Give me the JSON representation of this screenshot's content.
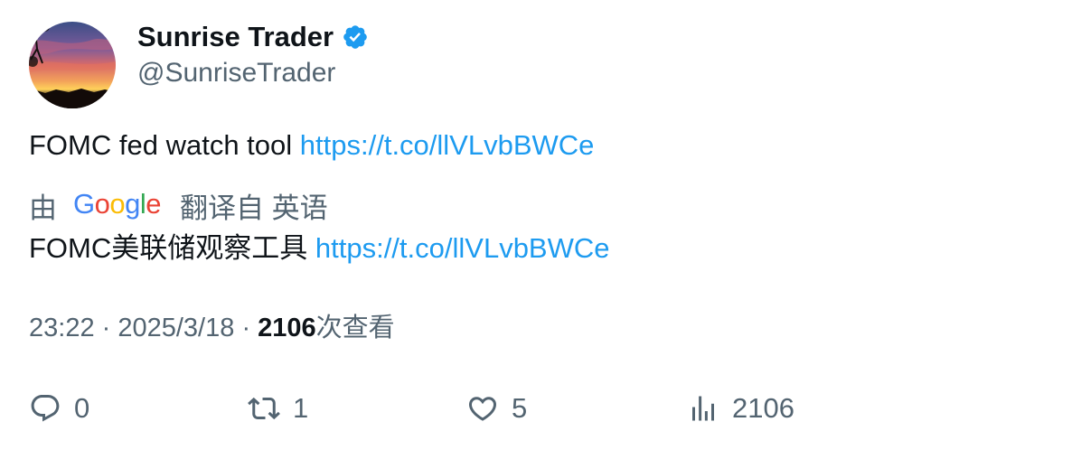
{
  "author": {
    "display_name": "Sunrise Trader",
    "handle": "@SunriseTrader",
    "verified": true,
    "verified_color": "#1d9bf0",
    "avatar_icon": "sunset-avatar"
  },
  "tweet": {
    "text": "FOMC fed watch tool",
    "link": "https://t.co/llVLvbBWCe"
  },
  "translation": {
    "by_label": "由",
    "provider_logo_text": "Google",
    "translated_from_label": "翻译自 英语",
    "text": "FOMC美联储观察工具",
    "link": "https://t.co/llVLvbBWCe"
  },
  "meta": {
    "time": "23:22",
    "separator": "·",
    "date": "2025/3/18",
    "views_count": "2106",
    "views_label": "次查看"
  },
  "actions": {
    "reply": {
      "icon": "reply-icon",
      "count": "0"
    },
    "retweet": {
      "icon": "retweet-icon",
      "count": "1"
    },
    "like": {
      "icon": "heart-icon",
      "count": "5"
    },
    "views": {
      "icon": "analytics-icon",
      "count": "2106"
    }
  },
  "colors": {
    "text_primary": "#0f1419",
    "text_secondary": "#536471",
    "link": "#1d9bf0"
  }
}
